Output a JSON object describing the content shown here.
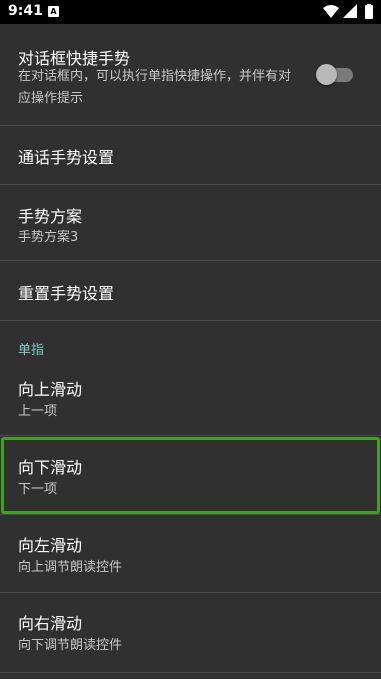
{
  "status_bar": {
    "time": "9:41",
    "notification_icon": "A",
    "icons": [
      "wifi-icon",
      "signal-icon",
      "battery-icon"
    ]
  },
  "settings": {
    "dialog_gesture": {
      "title": "对话框快捷手势",
      "summary": "在对话框内，可以执行单指快捷操作，并伴有对应操作提示",
      "enabled": false
    },
    "call_gesture": {
      "title": "通话手势设置"
    },
    "gesture_scheme": {
      "title": "手势方案",
      "summary": "手势方案3"
    },
    "reset_gesture": {
      "title": "重置手势设置"
    },
    "single_finger_category": "单指",
    "swipe_up": {
      "title": "向上滑动",
      "summary": "上一项"
    },
    "swipe_down": {
      "title": "向下滑动",
      "summary": "下一项"
    },
    "swipe_left": {
      "title": "向左滑动",
      "summary": "向上调节朗读控件"
    },
    "swipe_right": {
      "title": "向右滑动",
      "summary": "向下调节朗读控件"
    }
  },
  "colors": {
    "background": "#303030",
    "accent": "#80cbc4",
    "focus": "#3fa11d"
  }
}
